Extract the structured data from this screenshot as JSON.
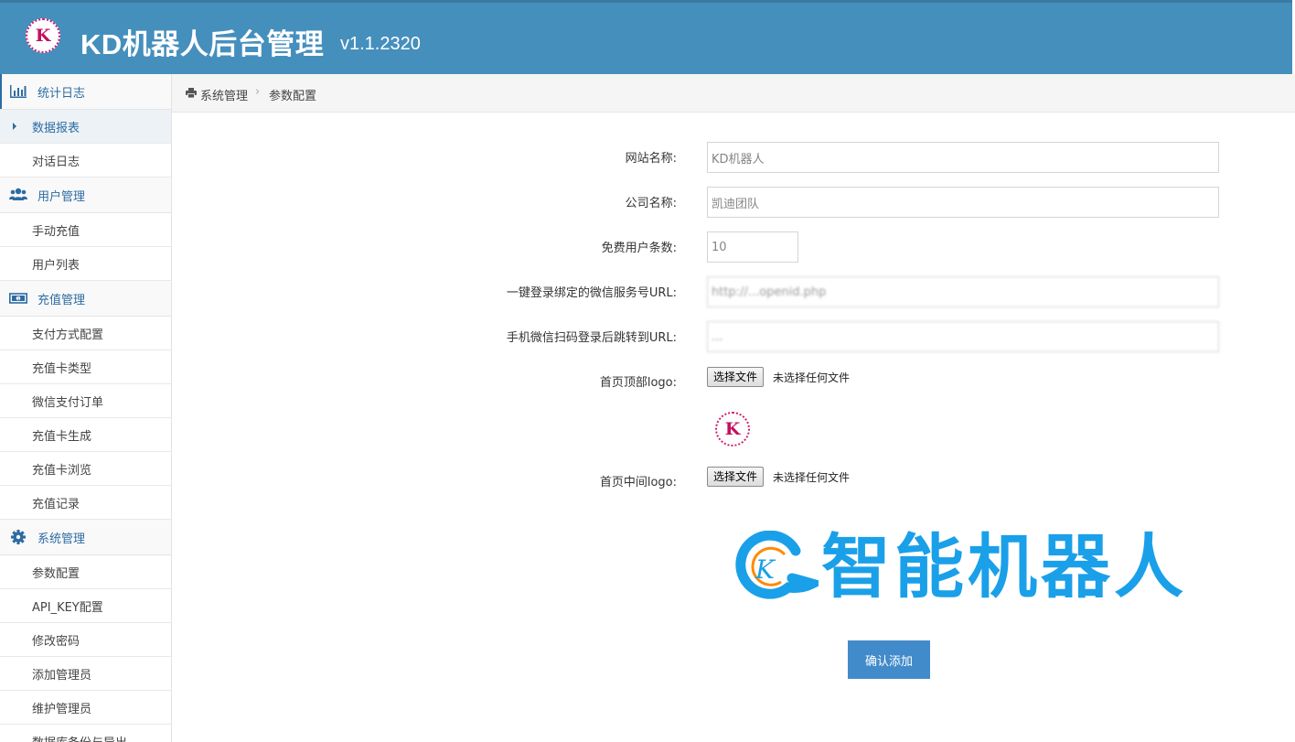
{
  "header": {
    "logo_letter": "K",
    "title": "KD机器人后台管理",
    "version": "v1.1.2320"
  },
  "sidebar": {
    "groups": [
      {
        "label": "统计日志",
        "icon": "bar-chart-icon",
        "items": [
          "数据报表",
          "对话日志"
        ]
      },
      {
        "label": "用户管理",
        "icon": "users-icon",
        "items": [
          "手动充值",
          "用户列表"
        ]
      },
      {
        "label": "充值管理",
        "icon": "money-icon",
        "items": [
          "支付方式配置",
          "充值卡类型",
          "微信支付订单",
          "充值卡生成",
          "充值卡浏览",
          "充值记录"
        ]
      },
      {
        "label": "系统管理",
        "icon": "gear-icon",
        "items": [
          "参数配置",
          "API_KEY配置",
          "修改密码",
          "添加管理员",
          "维护管理员",
          "数据库备份与导出"
        ]
      }
    ],
    "active_item": "数据报表"
  },
  "breadcrumb": {
    "icon": "printer-icon",
    "level1": "系统管理",
    "separator": "›",
    "level2": "参数配置"
  },
  "form": {
    "site_name": {
      "label": "网站名称:",
      "value": "KD机器人"
    },
    "company_name": {
      "label": "公司名称:",
      "value": "凯迪团队"
    },
    "free_user_count": {
      "label": "免费用户条数:",
      "value": "10"
    },
    "wechat_login_url": {
      "label": "一键登录绑定的微信服务号URL:",
      "value": "http://...openid.php"
    },
    "scan_redirect_url": {
      "label": "手机微信扫码登录后跳转到URL:",
      "value": "..."
    },
    "top_logo": {
      "label": "首页顶部logo:",
      "button": "选择文件",
      "status": "未选择任何文件"
    },
    "middle_logo": {
      "label": "首页中间logo:",
      "button": "选择文件",
      "status": "未选择任何文件"
    },
    "preview_top_letter": "K",
    "preview_middle_letter": "K",
    "preview_middle_text": "智能机器人",
    "submit_label": "确认添加"
  },
  "colors": {
    "header_bg": "#458fbd",
    "accent": "#2d6ca2",
    "button": "#428bca",
    "logo_pink": "#d4196f",
    "logo_blue": "#1aa0e8"
  }
}
